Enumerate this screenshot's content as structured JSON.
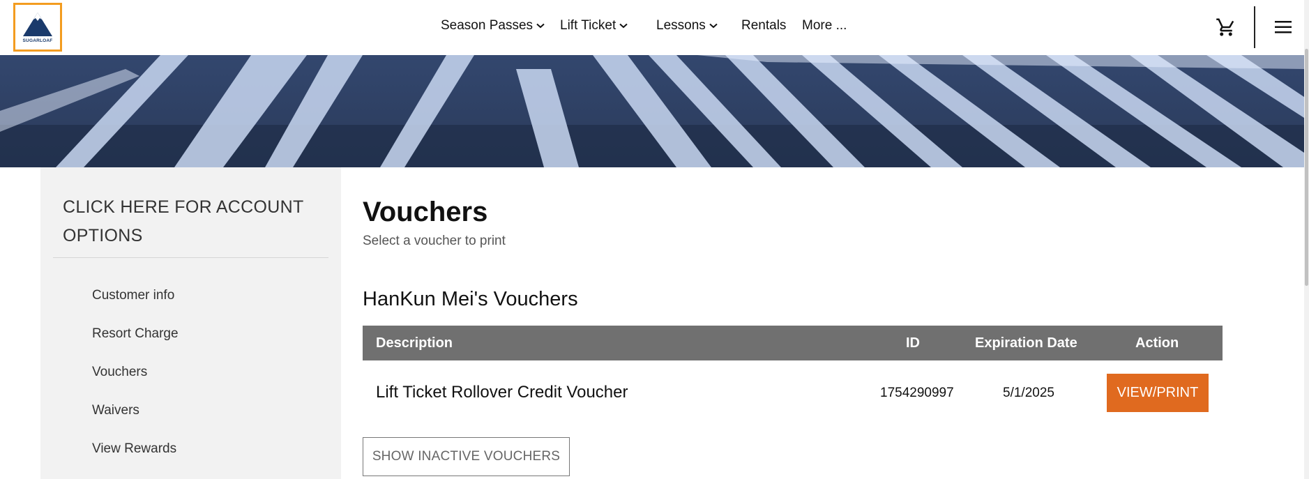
{
  "header": {
    "logo_text": "SUGARLOAF",
    "nav": [
      {
        "label": "Season Passes",
        "has_dropdown": true
      },
      {
        "label": "Lift Ticket",
        "has_dropdown": true
      },
      {
        "label": "Lessons",
        "has_dropdown": true
      },
      {
        "label": "Rentals",
        "has_dropdown": false
      },
      {
        "label": "More ...",
        "has_dropdown": false
      }
    ],
    "icons": {
      "cart": "cart-icon",
      "menu": "hamburger-menu-icon"
    }
  },
  "sidebar": {
    "title": "CLICK HERE FOR ACCOUNT OPTIONS",
    "items": [
      {
        "label": "Customer info"
      },
      {
        "label": "Resort Charge"
      },
      {
        "label": "Vouchers"
      },
      {
        "label": "Waivers"
      },
      {
        "label": "View Rewards"
      }
    ]
  },
  "main": {
    "title": "Vouchers",
    "subtitle": "Select a voucher to print",
    "section_title": "HanKun Mei's Vouchers",
    "table": {
      "columns": [
        "Description",
        "ID",
        "Expiration Date",
        "Action"
      ],
      "rows": [
        {
          "description": "Lift Ticket Rollover Credit Voucher",
          "id": "1754290997",
          "expiration": "5/1/2025",
          "action_label": "VIEW/PRINT"
        }
      ]
    },
    "show_inactive_label": "SHOW INACTIVE VOUCHERS"
  },
  "colors": {
    "accent": "#e06a1f",
    "logo_border": "#f39c20",
    "table_header": "#707070",
    "sidebar_bg": "#f2f2f2"
  }
}
